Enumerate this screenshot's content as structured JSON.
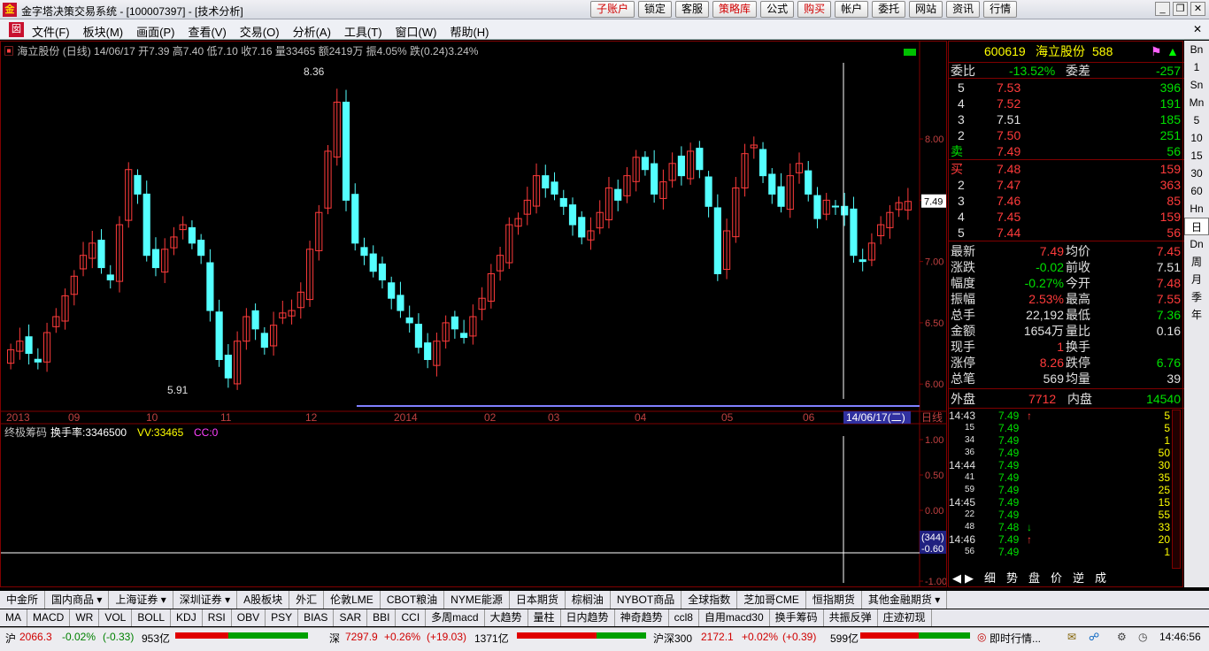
{
  "window": {
    "title": "金字塔决策交易系统 - [100007397] - [技术分析]"
  },
  "top_buttons": [
    "子账户",
    "锁定",
    "客服",
    "策略库",
    "公式",
    "购买",
    "帐户",
    "委托",
    "网站",
    "资讯",
    "行情"
  ],
  "menu": [
    "文件(F)",
    "板块(M)",
    "画面(P)",
    "查看(V)",
    "交易(O)",
    "分析(A)",
    "工具(T)",
    "窗口(W)",
    "帮助(H)"
  ],
  "chart_header": {
    "name": "海立股份 (日线)",
    "date": "14/06/17",
    "open": "开7.39",
    "high": "高7.40",
    "low": "低7.10",
    "close": "收7.16",
    "volume": "量33465",
    "amount": "额2419万",
    "amplitude": "振4.05%",
    "change": "跌(0.24)3.24%"
  },
  "indicator_header": {
    "name": "终极筹码",
    "turnover": "换手率:3346500",
    "vv": "VV:33465",
    "cc": "CC:0"
  },
  "chart_data": {
    "type": "candlestick",
    "title": "海立股份 (日线)",
    "x_axis_labels": [
      "2013",
      "09",
      "10",
      "11",
      "12",
      "2014",
      "02",
      "03",
      "04",
      "05",
      "06"
    ],
    "period_label": "日线",
    "cursor_date": "14/06/17(二)",
    "ylim": [
      5.85,
      8.65
    ],
    "y_ticks": [
      "8.00",
      "7.50",
      "7.00",
      "6.50",
      "6.00"
    ],
    "price_marker": "7.49",
    "annotations": {
      "max": "8.36",
      "min": "5.91"
    },
    "indicator_ticks": [
      "1.00",
      "0.50",
      "0.00",
      "-0.50",
      "-1.00"
    ],
    "indicator_cursor_value": "(344)",
    "indicator_value": "-0.60",
    "closes": [
      6.28,
      6.35,
      6.25,
      6.18,
      6.42,
      6.55,
      6.72,
      6.88,
      7.05,
      7.15,
      6.95,
      6.85,
      7.3,
      7.75,
      7.55,
      7.05,
      6.95,
      7.1,
      7.2,
      7.3,
      7.15,
      7.05,
      6.6,
      6.2,
      6.05,
      6.35,
      6.55,
      6.45,
      6.3,
      6.48,
      6.58,
      6.6,
      6.75,
      7.1,
      7.4,
      7.9,
      8.3,
      7.5,
      7.15,
      7.05,
      6.92,
      6.85,
      6.7,
      6.6,
      6.5,
      6.3,
      6.2,
      6.35,
      6.5,
      6.45,
      6.38,
      6.55,
      6.7,
      6.9,
      7.05,
      7.3,
      7.35,
      7.5,
      7.7,
      7.6,
      7.55,
      7.45,
      7.3,
      7.2,
      7.25,
      7.4,
      7.6,
      7.5,
      7.7,
      7.85,
      7.75,
      7.55,
      7.65,
      7.8,
      7.7,
      7.9,
      7.75,
      7.45,
      6.9,
      7.25,
      7.6,
      7.88,
      7.95,
      7.7,
      7.55,
      7.45,
      7.7,
      7.8,
      7.55,
      7.35,
      7.5,
      7.45,
      7.38,
      7.05,
      7.0,
      7.15,
      7.3,
      7.4,
      7.48,
      7.49
    ]
  },
  "quote": {
    "code": "600619",
    "name": "海立股份",
    "num": "588",
    "weibi_label": "委比",
    "weibi": "-13.52%",
    "weicha_label": "委差",
    "weicha": "-257",
    "asks": [
      [
        "5",
        "7.53",
        "396"
      ],
      [
        "4",
        "7.52",
        "191"
      ],
      [
        "3",
        "7.51",
        "185"
      ],
      [
        "2",
        "7.50",
        "251"
      ],
      [
        "卖",
        "7.49",
        "56"
      ]
    ],
    "bids": [
      [
        "买",
        "7.48",
        "159"
      ],
      [
        "2",
        "7.47",
        "363"
      ],
      [
        "3",
        "7.46",
        "85"
      ],
      [
        "4",
        "7.45",
        "159"
      ],
      [
        "5",
        "7.44",
        "56"
      ]
    ],
    "stats": [
      [
        "最新",
        "7.49",
        "均价",
        "7.45"
      ],
      [
        "涨跌",
        "-0.02",
        "前收",
        "7.51"
      ],
      [
        "幅度",
        "-0.27%",
        "今开",
        "7.48"
      ],
      [
        "振幅",
        "2.53%",
        "最高",
        "7.55"
      ],
      [
        "总手",
        "22,192",
        "最低",
        "7.36"
      ],
      [
        "金额",
        "1654万",
        "量比",
        "0.16"
      ],
      [
        "现手",
        "1",
        "换手",
        ""
      ],
      [
        "涨停",
        "8.26",
        "跌停",
        "6.76"
      ],
      [
        "总笔",
        "569",
        "均量",
        "39"
      ]
    ],
    "outer_label": "外盘",
    "outer": "7712",
    "inner_label": "内盘",
    "inner": "14540"
  },
  "ticks": [
    [
      "14:43",
      "7.49",
      "↑",
      "5"
    ],
    [
      "15",
      "7.49",
      "",
      "5"
    ],
    [
      "34",
      "7.49",
      "",
      "1"
    ],
    [
      "36",
      "7.49",
      "",
      "50"
    ],
    [
      "14:44",
      "7.49",
      "",
      "30"
    ],
    [
      "41",
      "7.49",
      "",
      "35"
    ],
    [
      "59",
      "7.49",
      "",
      "25"
    ],
    [
      "14:45",
      "7.49",
      "",
      "15"
    ],
    [
      "22",
      "7.49",
      "",
      "55"
    ],
    [
      "48",
      "7.48",
      "↓",
      "33"
    ],
    [
      "14:46",
      "7.49",
      "↑",
      "20"
    ],
    [
      "56",
      "7.49",
      "",
      "1"
    ]
  ],
  "tick_footer": [
    "◀",
    "▶",
    "细",
    "势",
    "盘",
    "价",
    "逆",
    "成"
  ],
  "sidebar": [
    "Bn",
    "1",
    "Sn",
    "Mn",
    "5",
    "10",
    "15",
    "30",
    "60",
    "Hn",
    "日",
    "Dn",
    "周",
    "月",
    "季",
    "年"
  ],
  "market_tabs": [
    "中金所",
    "国内商品 ▾",
    "上海证券 ▾",
    "深圳证券 ▾",
    "A股板块",
    "外汇",
    "伦敦LME",
    "CBOT粮油",
    "NYME能源",
    "日本期货",
    "棕榈油",
    "NYBOT商品",
    "全球指数",
    "芝加哥CME",
    "恒指期货",
    "其他金融期货 ▾"
  ],
  "indicator_tabs": [
    "MA",
    "MACD",
    "WR",
    "VOL",
    "BOLL",
    "KDJ",
    "RSI",
    "OBV",
    "PSY",
    "BIAS",
    "SAR",
    "BBI",
    "CCI",
    "多周macd",
    "大趋势",
    "量柱",
    "日内趋势",
    "神奇趋势",
    "ccl8",
    "自用macd30",
    "换手筹码",
    "共振反弹",
    "庄迹初现"
  ],
  "status": {
    "sh_label": "沪",
    "sh": "2066.3",
    "sh_chg": "-0.02%",
    "sh_pt": "(-0.33)",
    "sh_amt": "953亿",
    "sz_label": "深",
    "sz": "7297.9",
    "sz_chg": "+0.26%",
    "sz_pt": "(+19.03)",
    "sz_amt": "1371亿",
    "hs_label": "沪深300",
    "hs": "2172.1",
    "hs_chg": "+0.02%",
    "hs_pt": "(+0.39)",
    "hs_amt": "599亿",
    "news": "即时行情...",
    "time": "14:46:56"
  },
  "colors": {
    "up": "#ff3b3b",
    "down": "#54ffff",
    "frame": "#800000",
    "bg": "#000000"
  }
}
